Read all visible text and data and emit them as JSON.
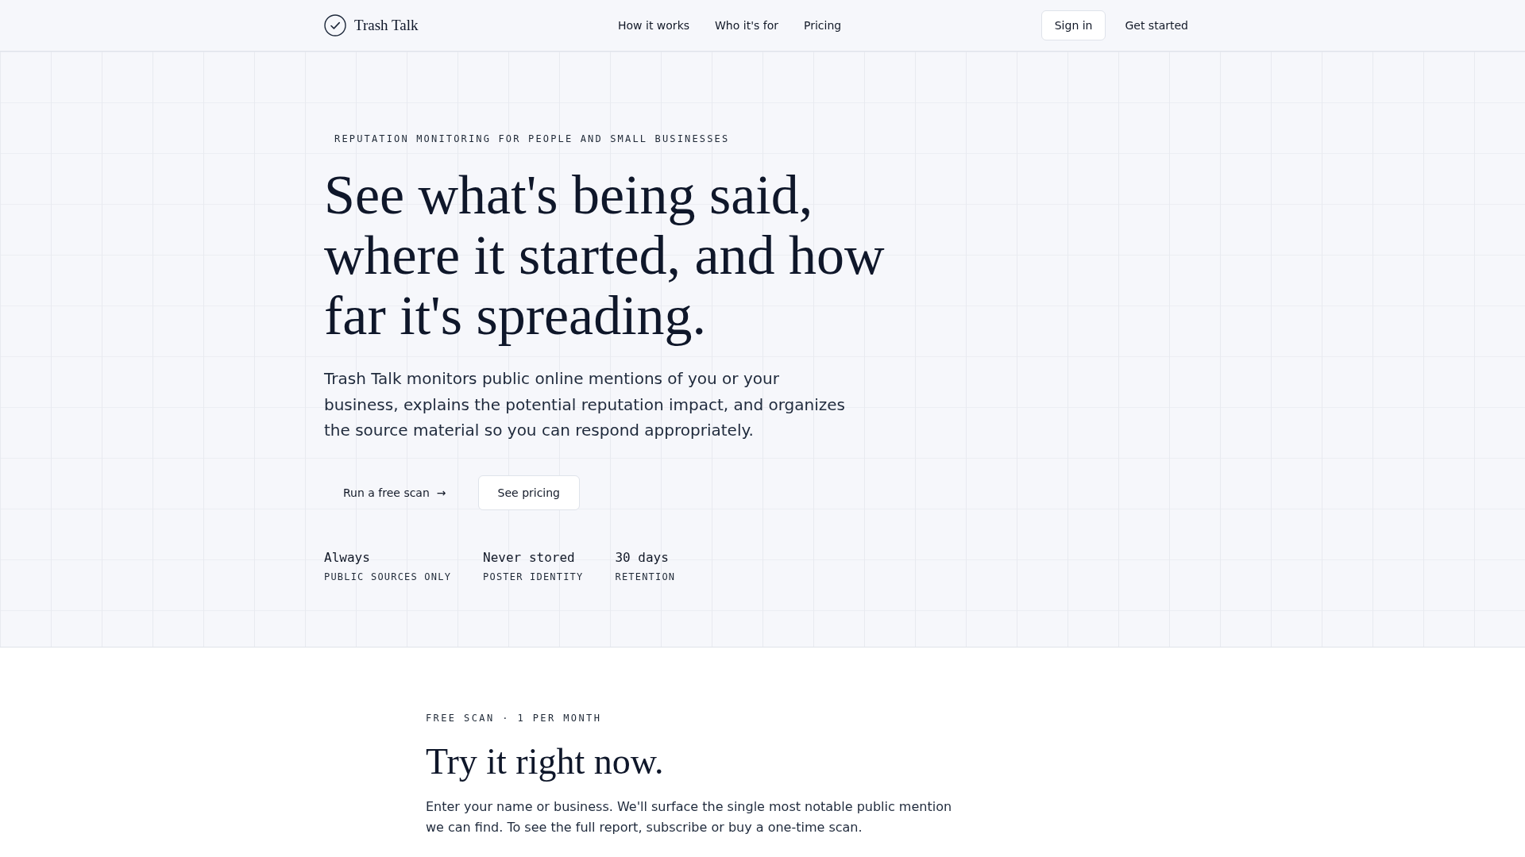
{
  "nav": {
    "brand": "Trash Talk",
    "links": [
      "How it works",
      "Who it's for",
      "Pricing"
    ],
    "sign_in": "Sign in",
    "get_started": "Get started"
  },
  "hero": {
    "eyebrow": "REPUTATION MONITORING FOR PEOPLE AND SMALL BUSINESSES",
    "heading": "See what's being said, where it started, and how far it's spreading.",
    "description": "Trash Talk monitors public online mentions of you or your business, explains the potential reputation impact, and organizes the source material so you can respond appropriately.",
    "primary_button": {
      "label": "Run a free scan",
      "arrow": "→"
    },
    "secondary_button": "See pricing",
    "stats": [
      {
        "value": "Always",
        "label": "PUBLIC SOURCES ONLY"
      },
      {
        "value": "Never stored",
        "label": "POSTER IDENTITY"
      },
      {
        "value": "30 days",
        "label": "RETENTION"
      }
    ]
  },
  "scan_section": {
    "eyebrow": "FREE SCAN · 1 PER MONTH",
    "heading": "Try it right now.",
    "description": "Enter your name or business. We'll surface the single most notable public mention we can find. To see the full report, subscribe or buy a one-time scan."
  }
}
